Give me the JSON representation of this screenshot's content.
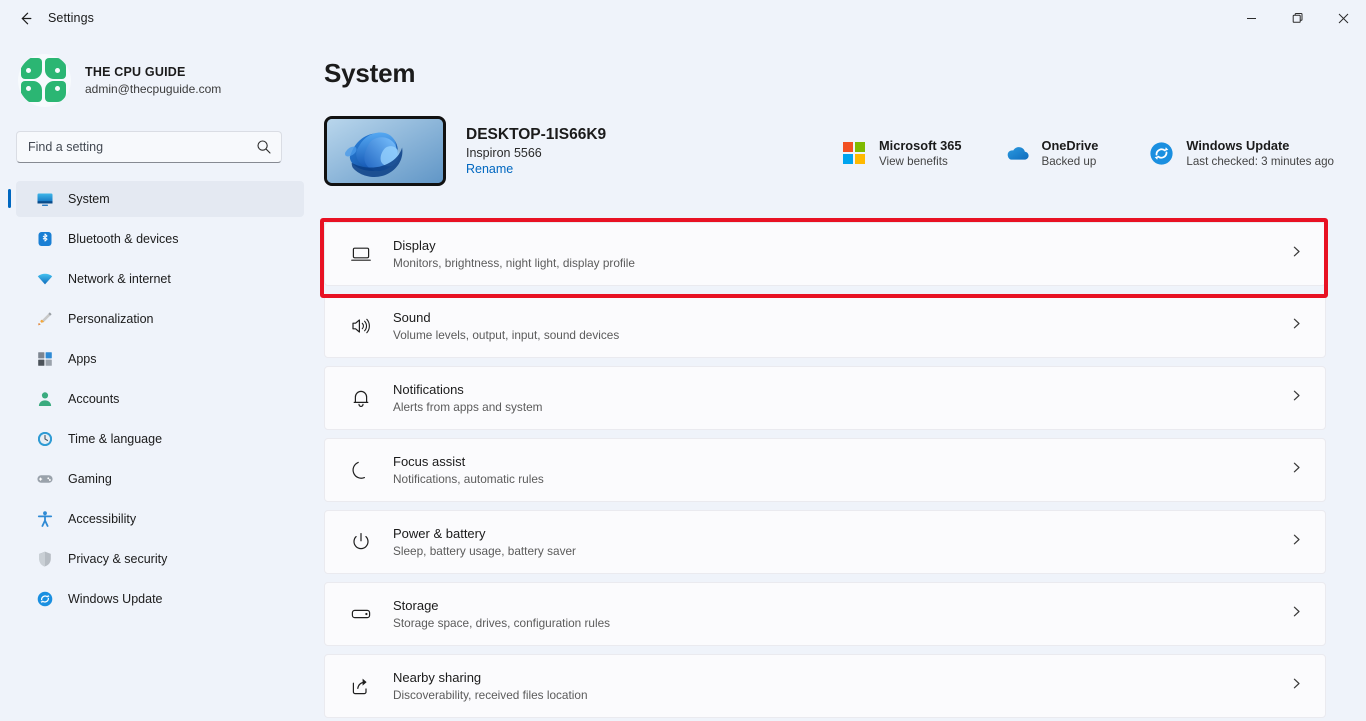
{
  "titlebar": {
    "back_icon": "back-arrow-icon",
    "title": "Settings",
    "minimize": "minimize-icon",
    "maximize": "maximize-icon",
    "close": "close-icon"
  },
  "sidebar": {
    "account": {
      "name": "THE CPU GUIDE",
      "email": "admin@thecpuguide.com",
      "avatar_icon": "clover-avatar"
    },
    "search": {
      "placeholder": "Find a setting",
      "value": "",
      "icon": "search-icon"
    },
    "items": [
      {
        "label": "System",
        "icon": "monitor-icon",
        "active": true
      },
      {
        "label": "Bluetooth & devices",
        "icon": "bluetooth-icon",
        "active": false
      },
      {
        "label": "Network & internet",
        "icon": "wifi-icon",
        "active": false
      },
      {
        "label": "Personalization",
        "icon": "paintbrush-icon",
        "active": false
      },
      {
        "label": "Apps",
        "icon": "apps-grid-icon",
        "active": false
      },
      {
        "label": "Accounts",
        "icon": "person-icon",
        "active": false
      },
      {
        "label": "Time & language",
        "icon": "clock-globe-icon",
        "active": false
      },
      {
        "label": "Gaming",
        "icon": "gamepad-icon",
        "active": false
      },
      {
        "label": "Accessibility",
        "icon": "accessibility-person-icon",
        "active": false
      },
      {
        "label": "Privacy & security",
        "icon": "shield-icon",
        "active": false
      },
      {
        "label": "Windows Update",
        "icon": "update-sync-icon",
        "active": false
      }
    ]
  },
  "main": {
    "page_title": "System",
    "device": {
      "thumbnail_icon": "windows-bloom-wallpaper",
      "name": "DESKTOP-1IS66K9",
      "model": "Inspiron 5566",
      "rename_label": "Rename"
    },
    "services": [
      {
        "title": "Microsoft 365",
        "subtitle": "View benefits",
        "icon": "microsoft-logo-icon"
      },
      {
        "title": "OneDrive",
        "subtitle": "Backed up",
        "icon": "onedrive-cloud-icon"
      },
      {
        "title": "Windows Update",
        "subtitle": "Last checked: 3 minutes ago",
        "icon": "update-sync-icon"
      }
    ],
    "rows": [
      {
        "title": "Display",
        "subtitle": "Monitors, brightness, night light, display profile",
        "icon": "display-monitor-icon",
        "chevron": "chevron-right-icon",
        "highlighted": true
      },
      {
        "title": "Sound",
        "subtitle": "Volume levels, output, input, sound devices",
        "icon": "speaker-icon",
        "chevron": "chevron-right-icon",
        "highlighted": false
      },
      {
        "title": "Notifications",
        "subtitle": "Alerts from apps and system",
        "icon": "bell-icon",
        "chevron": "chevron-right-icon",
        "highlighted": false
      },
      {
        "title": "Focus assist",
        "subtitle": "Notifications, automatic rules",
        "icon": "moon-icon",
        "chevron": "chevron-right-icon",
        "highlighted": false
      },
      {
        "title": "Power & battery",
        "subtitle": "Sleep, battery usage, battery saver",
        "icon": "power-icon",
        "chevron": "chevron-right-icon",
        "highlighted": false
      },
      {
        "title": "Storage",
        "subtitle": "Storage space, drives, configuration rules",
        "icon": "drive-icon",
        "chevron": "chevron-right-icon",
        "highlighted": false
      },
      {
        "title": "Nearby sharing",
        "subtitle": "Discoverability, received files location",
        "icon": "share-icon",
        "chevron": "chevron-right-icon",
        "highlighted": false
      }
    ]
  },
  "colors": {
    "accent": "#0067c0",
    "highlight_border": "#e81123",
    "window_background": "#eff3fa",
    "card_background": "#fbfbfd",
    "avatar_green": "#2bb673"
  }
}
